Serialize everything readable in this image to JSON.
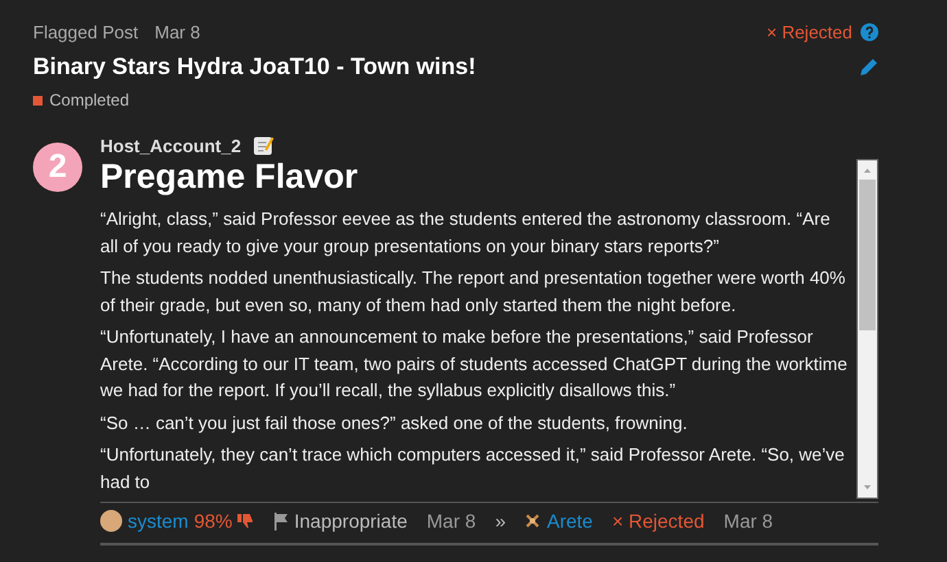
{
  "header": {
    "label": "Flagged Post",
    "date": "Mar 8",
    "status": {
      "icon": "×",
      "label": "Rejected"
    },
    "title": "Binary Stars Hydra JoaT10 - Town wins!",
    "category": {
      "label": "Completed",
      "color": "#e45735"
    }
  },
  "post": {
    "avatar_text": "2",
    "author": "Host_Account_2",
    "heading": "Pregame Flavor",
    "paragraphs": [
      "“Alright, class,” said Professor eevee as the students entered the astronomy classroom. “Are all of you ready to give your group presentations on your binary stars reports?”",
      "The students nodded unenthusiastically. The report and presentation together were worth 40% of their grade, but even so, many of them had only started them the night before.",
      "“Unfortunately, I have an announcement to make before the presentations,” said Professor Arete. “According to our IT team, two pairs of students accessed ChatGPT during the worktime we had for the report. If you’ll recall, the syllabus explicitly disallows this.”",
      "“So … can’t you just fail those ones?” asked one of the students, frowning.",
      "“Unfortunately, they can’t trace which computers accessed it,” said Professor Arete. “So, we’ve had to"
    ]
  },
  "flag": {
    "user": "system",
    "score": "98%",
    "reason": "Inappropriate",
    "date": "Mar 8",
    "separator": "»",
    "reviewer": "Arete",
    "result_icon": "×",
    "result": "Rejected",
    "result_date": "Mar 8"
  }
}
